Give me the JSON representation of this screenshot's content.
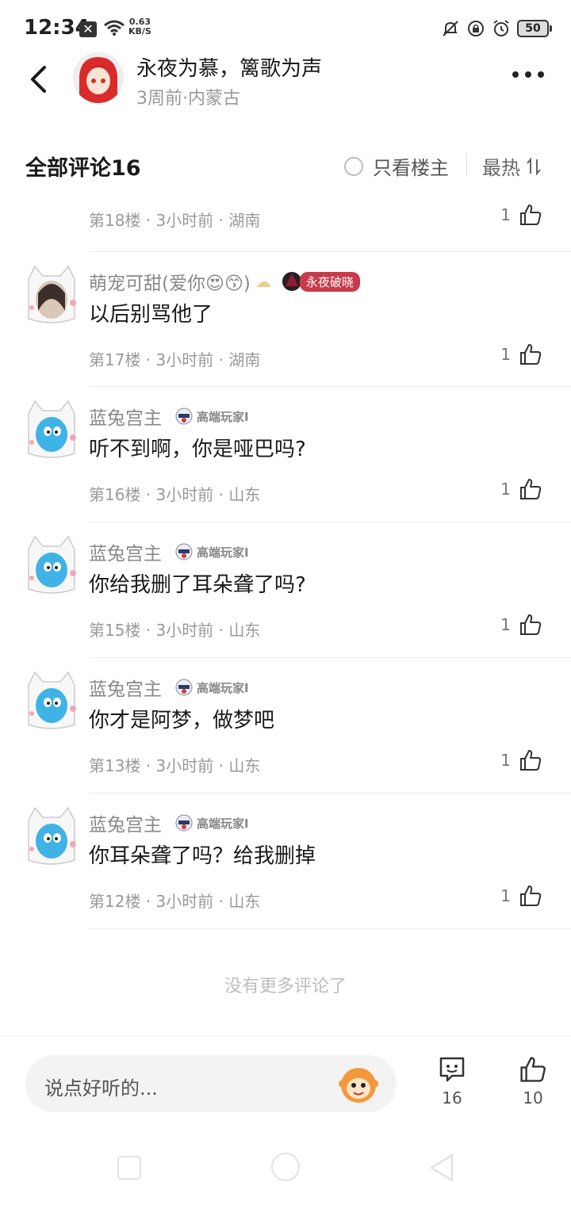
{
  "status_bar": {
    "time": "12:34",
    "notif_x": "✕",
    "net_speed_value": "0.63",
    "net_speed_unit": "KB/S",
    "battery": "50"
  },
  "header": {
    "title": "永夜为慕，篱歌为声",
    "subtitle": "3周前·内蒙古"
  },
  "comments_header": {
    "title": "全部评论16",
    "only_op_label": "只看楼主",
    "sort_label": "最热"
  },
  "first_meta": {
    "text": "第18楼 · 3小时前 · 湖南",
    "likes": "1"
  },
  "comments": [
    {
      "name": "萌宠可甜(爱你😍😙)",
      "badge": "永夜破晓",
      "text": "以后别骂他了",
      "meta": "第17楼 · 3小时前 · 湖南",
      "likes": "1"
    },
    {
      "name": "蓝兔宫主",
      "badge": "高端玩家I",
      "text": "听不到啊，你是哑巴吗?",
      "meta": "第16楼 · 3小时前 · 山东",
      "likes": "1"
    },
    {
      "name": "蓝兔宫主",
      "badge": "高端玩家I",
      "text": "你给我删了耳朵聋了吗?",
      "meta": "第15楼 · 3小时前 · 山东",
      "likes": "1"
    },
    {
      "name": "蓝兔宫主",
      "badge": "高端玩家I",
      "text": "你才是阿梦，做梦吧",
      "meta": "第13楼 · 3小时前 · 山东",
      "likes": "1"
    },
    {
      "name": "蓝兔宫主",
      "badge": "高端玩家I",
      "text": "你耳朵聋了吗？给我删掉",
      "meta": "第12楼 · 3小时前 · 山东",
      "likes": "1"
    }
  ],
  "no_more_text": "没有更多评论了",
  "bottom_bar": {
    "input_placeholder": "说点好听的...",
    "comment_count": "16",
    "like_count": "10"
  },
  "colors": {
    "accent_badge": "#c73a4a",
    "muted_text": "#999999"
  }
}
